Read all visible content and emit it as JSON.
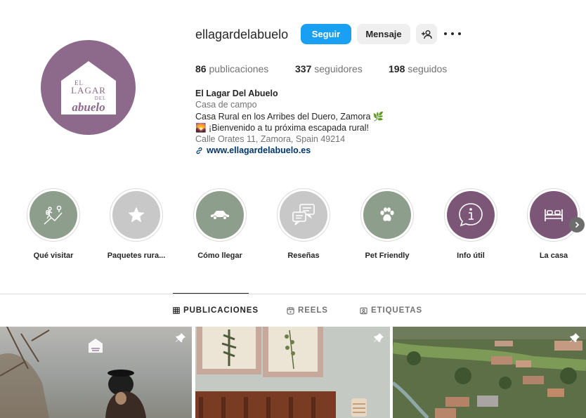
{
  "profile": {
    "username": "ellagardelabuelo",
    "logo_text": {
      "line1": "EL",
      "line2": "LAGAR",
      "line3": "DEL",
      "line4": "abuelo"
    }
  },
  "actions": {
    "follow": "Seguir",
    "message": "Mensaje",
    "suggest_icon": "person-add-icon",
    "more_icon": "more-options-icon"
  },
  "stats": {
    "posts_count": "86",
    "posts_label": "publicaciones",
    "followers_count": "337",
    "followers_label": "seguidores",
    "following_count": "198",
    "following_label": "seguidos"
  },
  "bio": {
    "name": "El Lagar Del Abuelo",
    "category": "Casa de campo",
    "line1": "Casa Rural en los Arribes del Duero, Zamora 🌿",
    "line2": "🌄 ¡Bienvenido a tu próxima escapada rural!",
    "address": "Calle Orates 11, Zamora, Spain 49214",
    "website": "www.ellagardelabuelo.es"
  },
  "highlights": [
    {
      "label": "Qué visitar",
      "icon": "hiker-icon",
      "color": "#8e9e8c"
    },
    {
      "label": "Paquetes rura...",
      "icon": "star-icon",
      "color": "#c8c8c8"
    },
    {
      "label": "Cómo llegar",
      "icon": "car-icon",
      "color": "#8e9e8c"
    },
    {
      "label": "Reseñas",
      "icon": "chat-bubbles-icon",
      "color": "#c8c8c8"
    },
    {
      "label": "Pet Friendly",
      "icon": "paw-icon",
      "color": "#8e9e8c"
    },
    {
      "label": "Info útil",
      "icon": "info-icon",
      "color": "#7c5677"
    },
    {
      "label": "La casa",
      "icon": "bed-icon",
      "color": "#7c5677"
    }
  ],
  "tabs": [
    {
      "label": "PUBLICACIONES",
      "icon": "grid-icon",
      "active": true
    },
    {
      "label": "REELS",
      "icon": "reels-icon",
      "active": false
    },
    {
      "label": "ETIQUETAS",
      "icon": "tagged-icon",
      "active": false
    }
  ],
  "colors": {
    "accent": "#1aa0f2",
    "brand_purple": "#8d6a8b",
    "sage": "#8e9e8c",
    "link": "#00376b"
  }
}
